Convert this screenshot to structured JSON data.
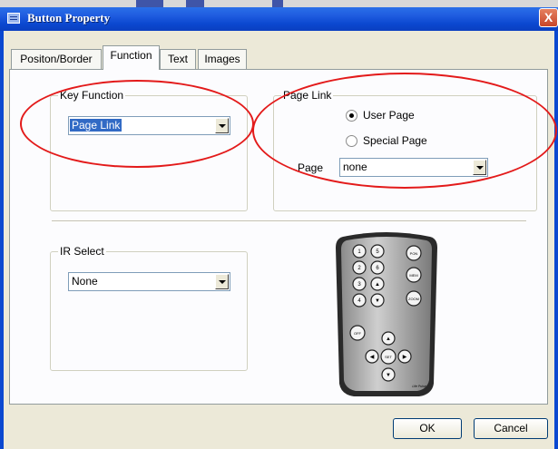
{
  "window": {
    "title": "Button Property",
    "close_glyph": "X"
  },
  "tabs": [
    {
      "label": "Positon/Border",
      "active": false
    },
    {
      "label": "Function",
      "active": true
    },
    {
      "label": "Text",
      "active": false
    },
    {
      "label": "Images",
      "active": false
    }
  ],
  "key_function": {
    "legend": "Key Function",
    "value": "Page Link"
  },
  "page_link": {
    "legend": "Page Link",
    "options": [
      {
        "label": "User Page",
        "checked": true
      },
      {
        "label": "Special Page",
        "checked": false
      }
    ],
    "page_label": "Page",
    "page_value": "none"
  },
  "ir_select": {
    "legend": "IR Select",
    "value": "None"
  },
  "remote": {
    "number_buttons": [
      "1",
      "5",
      "2",
      "6",
      "3",
      "▲",
      "4",
      "▼"
    ],
    "side_buttons": [
      "PON",
      "MEM",
      "ZOOM"
    ],
    "off_label": "OFF",
    "dpad": {
      "up": "▲",
      "left": "◀",
      "center": "SET",
      "right": "▶",
      "down": "▼"
    },
    "brand": "Life Pulse"
  },
  "buttons": {
    "ok": "OK",
    "cancel": "Cancel"
  },
  "colors": {
    "titlebar": "#0b48d0",
    "annotation": "#e31a1a",
    "selection": "#316ac5"
  }
}
